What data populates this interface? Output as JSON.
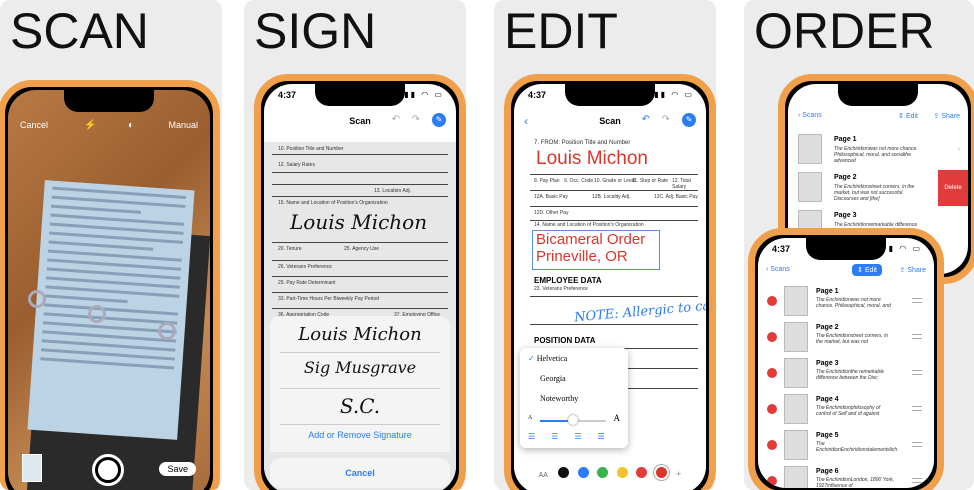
{
  "panels": {
    "scan": {
      "headline": "SCAN",
      "cancel": "Cancel",
      "manual": "Manual",
      "save": "Save"
    },
    "sign": {
      "headline": "SIGN",
      "time": "4:37",
      "title": "Scan",
      "doc_labels": [
        "10. Position Title and Number",
        "12. Salary Rates",
        "13. Location Adj.",
        "15. Name and Location of Position's Organization",
        "20. Tenure",
        "25. Agency Use",
        "26. Veterans Preference",
        "29. Pay Rate Determinant",
        "33. Part-Time Hours Per Biweekly Pay Period",
        "36. Appropriation Code",
        "37. Employing Office"
      ],
      "doc_signature": "Louis Michon",
      "signatures": [
        "Louis Michon",
        "Sig Musgrave",
        "S.C."
      ],
      "add_remove": "Add or Remove Signature",
      "cancel": "Cancel"
    },
    "edit": {
      "headline": "EDIT",
      "time": "4:37",
      "title": "Scan",
      "from_label": "7. FROM: Position Title and Number",
      "name_text": "Louis Michon",
      "field_labels": [
        "8. Pay Plan",
        "9. Occ. Code",
        "10. Grade or Level",
        "11. Step or Rate",
        "12. Total Salary",
        "12A. Basic Pay",
        "12B. Locality Adj.",
        "12C. Adj. Basic Pay",
        "12D. Other Pay",
        "14. Name and Location of Position's Organization"
      ],
      "org_line1": "Bicameral Order",
      "org_line2": "Prineville, OR",
      "employee_data": "EMPLOYEE DATA",
      "vet_pref": "23. Veterans Preference",
      "note": "NOTE: Allergic to cats",
      "position_data": "POSITION DATA",
      "fonts": [
        "Helvetica",
        "Georgia",
        "Noteworthy"
      ],
      "aa": "AA",
      "colors": [
        "#111111",
        "#2b7cf6",
        "#36b34a",
        "#f2c12e",
        "#e23b3b",
        "#d9372c"
      ]
    },
    "order": {
      "headline": "ORDER",
      "back": "Scans",
      "edit": "Edit",
      "share": "Share",
      "delete": "Delete",
      "back_pages": [
        {
          "title": "Page 1",
          "desc": "The Enchiridionwas not more chance. Philosophical, moral, and socialthe advanced"
        },
        {
          "title": "Page 2",
          "desc": "The Enchiridionstreet corners, in the market, but was not successful Discourses and [the]"
        },
        {
          "title": "Page 3",
          "desc": "The Enchiridionremarkable difference between the Discourses and theEnchiridion is"
        }
      ],
      "front_time": "4:37",
      "front_pages": [
        {
          "title": "Page 1",
          "desc": "The Enchiridionwas not more chance. Philosophical, moral, and"
        },
        {
          "title": "Page 2",
          "desc": "The Enchiridionstreet corners, in the market, but was not"
        },
        {
          "title": "Page 3",
          "desc": "The Enchiridionthe remarkable difference between the Disc"
        },
        {
          "title": "Page 4",
          "desc": "The Enchiridionphilosophy of control of Self and of against"
        },
        {
          "title": "Page 5",
          "desc": "The EnchiridionEnchiridionstalementslich."
        },
        {
          "title": "Page 6",
          "desc": "The EnchiridionLondon, 1890 York, 1927influence of"
        }
      ]
    }
  }
}
